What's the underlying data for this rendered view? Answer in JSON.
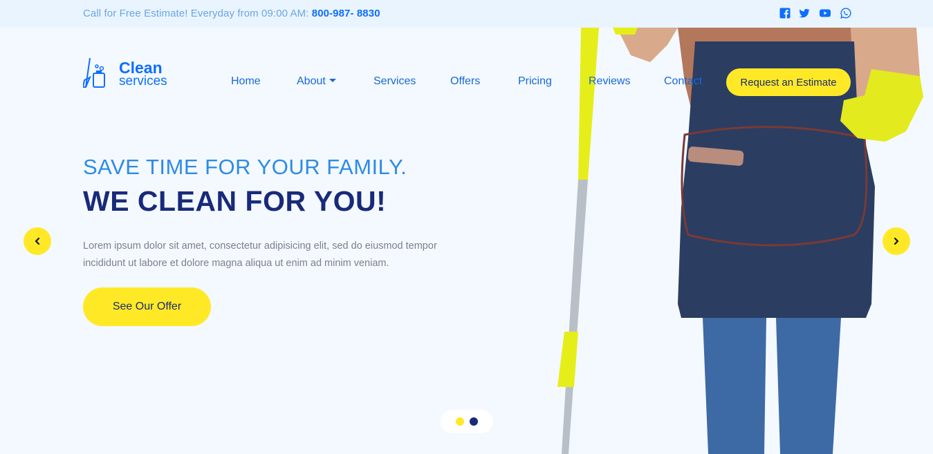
{
  "topbar": {
    "text": "Call for Free Estimate! Everyday from 09:00 AM: ",
    "phone": "800-987- 8830",
    "social": [
      "facebook-icon",
      "twitter-icon",
      "youtube-icon",
      "whatsapp-icon"
    ]
  },
  "logo": {
    "name": "Clean",
    "sub": "services"
  },
  "nav": {
    "items": [
      "Home",
      "About",
      "Services",
      "Offers",
      "Pricing",
      "Reviews",
      "Contact"
    ],
    "cta": "Request an Estimate"
  },
  "hero": {
    "kicker": "SAVE TIME FOR YOUR FAMILY.",
    "title": "WE CLEAN FOR YOU!",
    "description": "Lorem ipsum dolor sit amet, consectetur adipisicing elit, sed do eiusmod tempor incididunt ut labore et dolore magna aliqua ut enim ad minim veniam.",
    "button": "See Our Offer"
  },
  "carousel": {
    "prev_icon": "chevron-left-icon",
    "next_icon": "chevron-right-icon",
    "slides": 2,
    "active_slide": 1
  },
  "colors": {
    "accent_yellow": "#ffe927",
    "brand_blue": "#0d6efd",
    "title_navy": "#192a7a",
    "background": "#f4f9ff"
  }
}
